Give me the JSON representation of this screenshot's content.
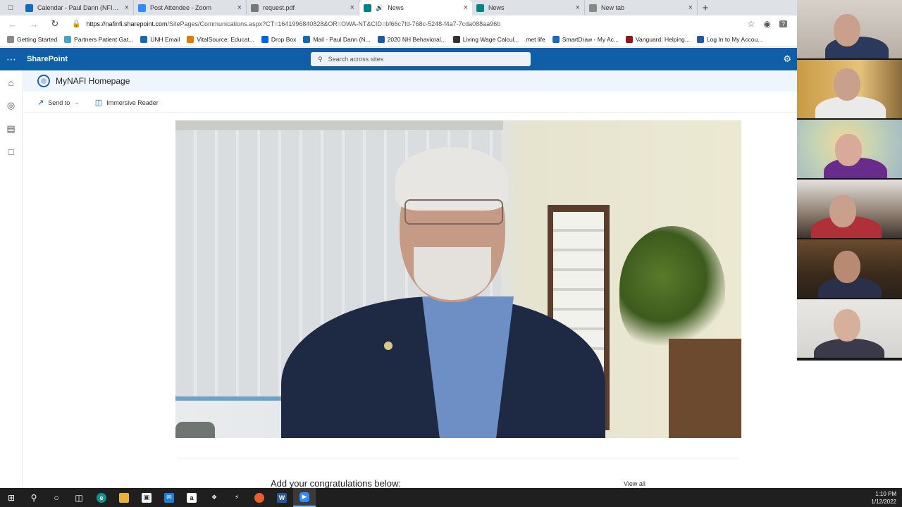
{
  "browser": {
    "tabs": [
      {
        "title": "Calendar - Paul Dann (NFI NORTH",
        "favicon": "outlook-icon",
        "color": "#0f6cbd",
        "active": false
      },
      {
        "title": "Post Attendee - Zoom",
        "favicon": "zoom-icon",
        "color": "#2d8cff",
        "active": false
      },
      {
        "title": "request.pdf",
        "favicon": "document-icon",
        "color": "#777777",
        "active": false
      },
      {
        "title": "News",
        "favicon": "sharepoint-icon",
        "color": "#038387",
        "active": true,
        "audio": true
      },
      {
        "title": "News",
        "favicon": "sharepoint-icon",
        "color": "#038387",
        "active": false
      },
      {
        "title": "New tab",
        "favicon": "newtab-icon",
        "color": "#888888",
        "active": false
      }
    ],
    "url_host": "https://nafinfi.sharepoint.com",
    "url_path": "/SitePages/Communications.aspx?CT=1641996840828&OR=OWA-NT&CID=bf66c7fd-768c-5248-f4a7-7cda088aa96b",
    "bookmarks": [
      {
        "label": "Getting Started",
        "icon": "page-icon",
        "color": "#888888"
      },
      {
        "label": "Partners Patient Gat...",
        "icon": "cloud-icon",
        "color": "#3fa6c9"
      },
      {
        "label": "UNH Email",
        "icon": "outlook-icon",
        "color": "#0f6cbd"
      },
      {
        "label": "VitalSource: Educat...",
        "icon": "vitalsource-icon",
        "color": "#e07b00"
      },
      {
        "label": "Drop Box",
        "icon": "dropbox-icon",
        "color": "#0061fe"
      },
      {
        "label": "Mail - Paul Dann (N...",
        "icon": "outlook-icon",
        "color": "#0f6cbd"
      },
      {
        "label": "2020 NH Behavioral...",
        "icon": "report-icon",
        "color": "#1e5aa8"
      },
      {
        "label": "Living Wage Calcul...",
        "icon": "calculator-icon",
        "color": "#333333"
      },
      {
        "label": "met life",
        "icon": "",
        "color": "#ffffff"
      },
      {
        "label": "SmartDraw - My Ac...",
        "icon": "smartdraw-icon",
        "color": "#1a6bbf"
      },
      {
        "label": "Vanguard: Helping...",
        "icon": "vanguard-icon",
        "color": "#96151d"
      },
      {
        "label": "Log In to My Accou...",
        "icon": "account-icon",
        "color": "#1e5aa8"
      }
    ]
  },
  "sharepoint": {
    "brand": "SharePoint",
    "search_placeholder": "Search across sites",
    "site_title": "MyNAFI Homepage",
    "commands": {
      "send_to": "Send to",
      "immersive_reader": "Immersive Reader"
    },
    "congrats_heading": "Add your congratulations below:",
    "view_all": "View all"
  },
  "taskbar": {
    "time": "1:10 PM",
    "date": "1/12/2022"
  },
  "colors": {
    "suite_bar": "#0f5fa8",
    "site_header": "#eef5fc",
    "taskbar": "#1f1f1f"
  }
}
